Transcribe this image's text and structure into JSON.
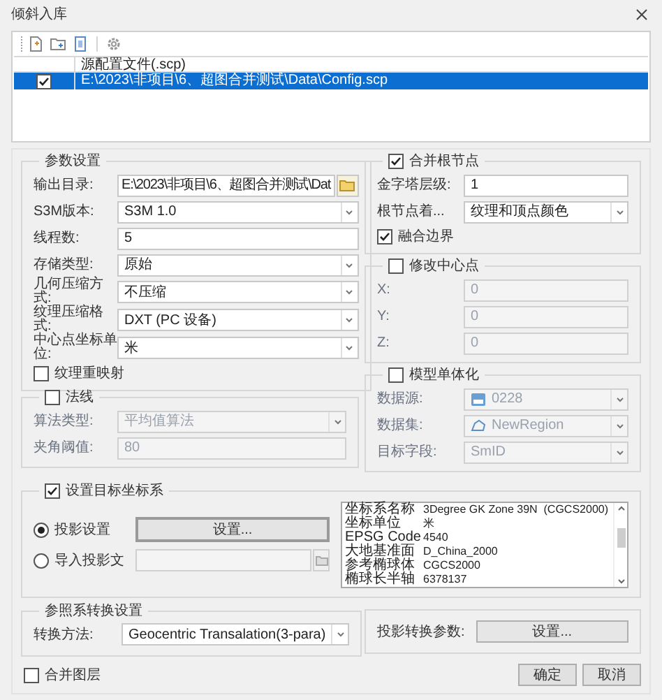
{
  "window": {
    "title": "倾斜入库"
  },
  "file_table": {
    "columns": [
      "源配置文件(.scp)"
    ],
    "rows": [
      {
        "checked": true,
        "selected": true,
        "path": "E:\\2023\\非项目\\6、超图合并测试\\Data\\Config.scp"
      }
    ]
  },
  "params": {
    "title": "参数设置",
    "fields": [
      {
        "label": "输出目录:",
        "value": "E:\\2023\\非项目\\6、超图合并测试\\Dat",
        "kind": "browse"
      },
      {
        "label": "S3M版本:",
        "value": "S3M 1.0",
        "kind": "dropdown"
      },
      {
        "label": "线程数:",
        "value": "5",
        "kind": "text"
      },
      {
        "label": "存储类型:",
        "value": "原始",
        "kind": "dropdown"
      },
      {
        "label": "几何压缩方式:",
        "value": "不压缩",
        "kind": "dropdown"
      },
      {
        "label": "纹理压缩格式:",
        "value": "DXT (PC 设备)",
        "kind": "dropdown"
      },
      {
        "label": "中心点坐标单位:",
        "value": "米",
        "kind": "dropdown"
      }
    ],
    "texture_remap": {
      "label": "纹理重映射",
      "checked": false
    }
  },
  "normals": {
    "title": "法线",
    "checked": false,
    "fields": [
      {
        "label": "算法类型:",
        "value": "平均值算法",
        "kind": "dropdown"
      },
      {
        "label": "夹角阈值:",
        "value": "80",
        "kind": "text"
      }
    ]
  },
  "merge_root": {
    "title": "合并根节点",
    "checked": true,
    "fields": [
      {
        "label": "金字塔层级:",
        "value": "1",
        "kind": "text"
      },
      {
        "label": "根节点着...",
        "value": "纹理和顶点颜色",
        "kind": "dropdown"
      }
    ],
    "merge_boundary": {
      "label": "融合边界",
      "checked": true
    }
  },
  "modify_center": {
    "title": "修改中心点",
    "checked": false,
    "fields": [
      {
        "label": "X:",
        "value": "0",
        "kind": "text"
      },
      {
        "label": "Y:",
        "value": "0",
        "kind": "text"
      },
      {
        "label": "Z:",
        "value": "0",
        "kind": "text"
      }
    ]
  },
  "model_unit": {
    "title": "模型单体化",
    "checked": false,
    "fields": [
      {
        "label": "数据源:",
        "value": "0228",
        "kind": "datasource"
      },
      {
        "label": "数据集:",
        "value": "NewRegion",
        "kind": "dataset"
      },
      {
        "label": "目标字段:",
        "value": "SmID",
        "kind": "dropdown"
      }
    ]
  },
  "target_crs": {
    "title": "设置目标坐标系",
    "checked": true,
    "options": [
      {
        "label": "投影设置",
        "selected": true,
        "kind": "button",
        "button": "设置..."
      },
      {
        "label": "导入投影文",
        "selected": false,
        "kind": "file"
      }
    ],
    "info": [
      {
        "name": "坐标系名称",
        "value": "3Degree GK Zone 39N  (CGCS2000)"
      },
      {
        "name": "坐标单位",
        "value": "米"
      },
      {
        "name": "EPSG Code",
        "value": "4540"
      },
      {
        "name": "大地基准面",
        "value": "D_China_2000"
      },
      {
        "name": "参考椭球体",
        "value": "CGCS2000"
      },
      {
        "name": "椭球长半轴",
        "value": "6378137"
      }
    ]
  },
  "transform": {
    "title": "参照系转换设置",
    "method": {
      "label": "转换方法:",
      "value": "Geocentric Transalation(3-para)"
    },
    "params": {
      "label": "投影转换参数:",
      "button": "设置..."
    }
  },
  "merge_layers": {
    "label": "合并图层",
    "checked": false
  },
  "buttons": [
    "确定",
    "取消"
  ]
}
